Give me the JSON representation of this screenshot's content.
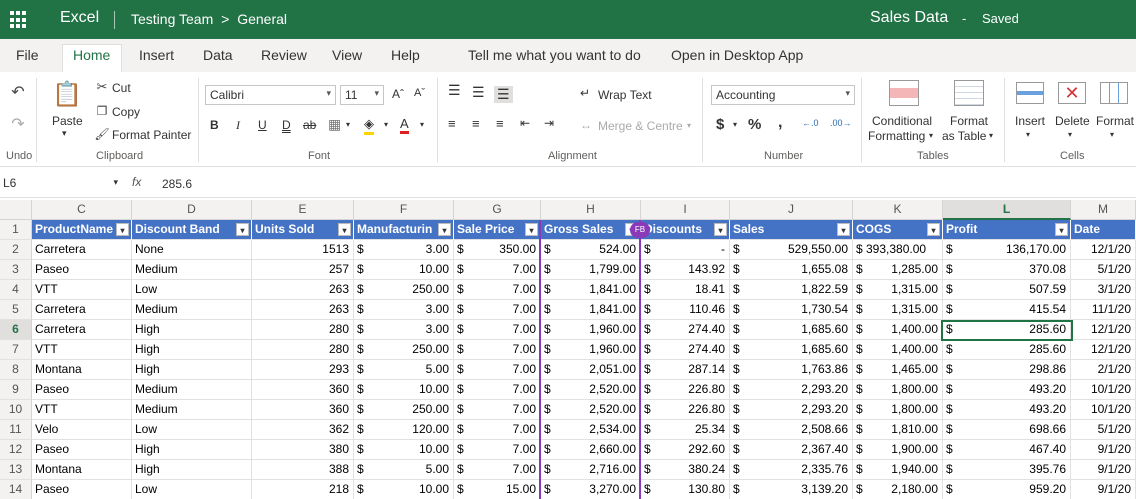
{
  "titlebar": {
    "app": "Excel",
    "path_team": "Testing Team",
    "path_sep": ">",
    "path_channel": "General",
    "doc_title": "Sales Data",
    "dash": "-",
    "status": "Saved"
  },
  "menu": [
    "File",
    "Home",
    "Insert",
    "Data",
    "Review",
    "View",
    "Help",
    "Tell me what you want to do",
    "Open in Desktop App"
  ],
  "ribbon": {
    "undo_label": "Undo",
    "paste": "Paste",
    "cut": "Cut",
    "copy": "Copy",
    "format_painter": "Format Painter",
    "clipboard": "Clipboard",
    "font_name": "Calibri",
    "font_size": "11",
    "font": "Font",
    "wrap_text": "Wrap Text",
    "merge_centre": "Merge & Centre",
    "alignment": "Alignment",
    "number_format": "Accounting",
    "number": "Number",
    "conditional_1": "Conditional",
    "conditional_2": "Formatting",
    "format_table_1": "Format",
    "format_table_2": "as Table",
    "tables": "Tables",
    "insert": "Insert",
    "delete": "Delete",
    "format": "Format",
    "cells": "Cells"
  },
  "formula_bar": {
    "name_box": "L6",
    "fx": "fx",
    "value": "285.6"
  },
  "grid": {
    "columns": [
      "C",
      "D",
      "E",
      "F",
      "G",
      "H",
      "I",
      "J",
      "K",
      "L",
      "M"
    ],
    "selected_column": "L",
    "selected_row": 6,
    "headers": [
      "ProductName",
      "Discount Band",
      "Units Sold",
      "Manufacturin",
      "Sale Price",
      "Gross Sales",
      "Discounts",
      "Sales",
      "COGS",
      "Profit",
      "Date"
    ],
    "fb_badge": "FB",
    "currency": "$",
    "rows": [
      {
        "n": 2,
        "product": "Carretera",
        "band": "None",
        "units": "1513",
        "mfg": "3.00",
        "price": "350.00",
        "gross": "524.00",
        "disc": "-",
        "sales": "529,550.00",
        "cogs": "$ 393,380.00",
        "profit": "136,170.00",
        "date": "12/1/20"
      },
      {
        "n": 3,
        "product": "Paseo",
        "band": "Medium",
        "units": "257",
        "mfg": "10.00",
        "price": "7.00",
        "gross": "1,799.00",
        "disc": "143.92",
        "sales": "1,655.08",
        "cogs": "1,285.00",
        "profit": "370.08",
        "date": "5/1/20"
      },
      {
        "n": 4,
        "product": "VTT",
        "band": "Low",
        "units": "263",
        "mfg": "250.00",
        "price": "7.00",
        "gross": "1,841.00",
        "disc": "18.41",
        "sales": "1,822.59",
        "cogs": "1,315.00",
        "profit": "507.59",
        "date": "3/1/20"
      },
      {
        "n": 5,
        "product": "Carretera",
        "band": "Medium",
        "units": "263",
        "mfg": "3.00",
        "price": "7.00",
        "gross": "1,841.00",
        "disc": "110.46",
        "sales": "1,730.54",
        "cogs": "1,315.00",
        "profit": "415.54",
        "date": "11/1/20"
      },
      {
        "n": 6,
        "product": "Carretera",
        "band": "High",
        "units": "280",
        "mfg": "3.00",
        "price": "7.00",
        "gross": "1,960.00",
        "disc": "274.40",
        "sales": "1,685.60",
        "cogs": "1,400.00",
        "profit": "285.60",
        "date": "12/1/20"
      },
      {
        "n": 7,
        "product": "VTT",
        "band": "High",
        "units": "280",
        "mfg": "250.00",
        "price": "7.00",
        "gross": "1,960.00",
        "disc": "274.40",
        "sales": "1,685.60",
        "cogs": "1,400.00",
        "profit": "285.60",
        "date": "12/1/20"
      },
      {
        "n": 8,
        "product": "Montana",
        "band": "High",
        "units": "293",
        "mfg": "5.00",
        "price": "7.00",
        "gross": "2,051.00",
        "disc": "287.14",
        "sales": "1,763.86",
        "cogs": "1,465.00",
        "profit": "298.86",
        "date": "2/1/20"
      },
      {
        "n": 9,
        "product": "Paseo",
        "band": "Medium",
        "units": "360",
        "mfg": "10.00",
        "price": "7.00",
        "gross": "2,520.00",
        "disc": "226.80",
        "sales": "2,293.20",
        "cogs": "1,800.00",
        "profit": "493.20",
        "date": "10/1/20"
      },
      {
        "n": 10,
        "product": "VTT",
        "band": "Medium",
        "units": "360",
        "mfg": "250.00",
        "price": "7.00",
        "gross": "2,520.00",
        "disc": "226.80",
        "sales": "2,293.20",
        "cogs": "1,800.00",
        "profit": "493.20",
        "date": "10/1/20"
      },
      {
        "n": 11,
        "product": "Velo",
        "band": "Low",
        "units": "362",
        "mfg": "120.00",
        "price": "7.00",
        "gross": "2,534.00",
        "disc": "25.34",
        "sales": "2,508.66",
        "cogs": "1,810.00",
        "profit": "698.66",
        "date": "5/1/20"
      },
      {
        "n": 12,
        "product": "Paseo",
        "band": "High",
        "units": "380",
        "mfg": "10.00",
        "price": "7.00",
        "gross": "2,660.00",
        "disc": "292.60",
        "sales": "2,367.40",
        "cogs": "1,900.00",
        "profit": "467.40",
        "date": "9/1/20"
      },
      {
        "n": 13,
        "product": "Montana",
        "band": "High",
        "units": "388",
        "mfg": "5.00",
        "price": "7.00",
        "gross": "2,716.00",
        "disc": "380.24",
        "sales": "2,335.76",
        "cogs": "1,940.00",
        "profit": "395.76",
        "date": "9/1/20"
      },
      {
        "n": 14,
        "product": "Paseo",
        "band": "Low",
        "units": "218",
        "mfg": "10.00",
        "price": "15.00",
        "gross": "3,270.00",
        "disc": "130.80",
        "sales": "3,139.20",
        "cogs": "2,180.00",
        "profit": "959.20",
        "date": "9/1/20"
      }
    ]
  }
}
